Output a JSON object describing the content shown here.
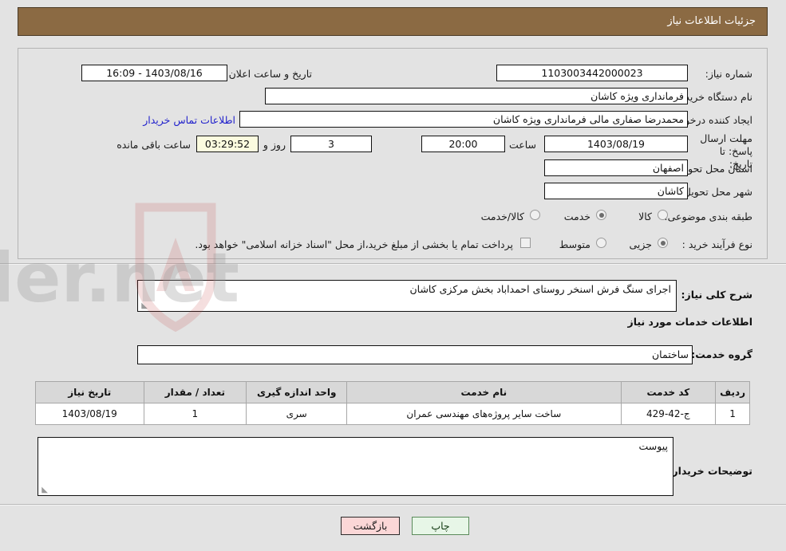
{
  "header": {
    "title": "جزئیات اطلاعات نیاز"
  },
  "form": {
    "need_number": {
      "label": "شماره نیاز:",
      "value": "1103003442000023"
    },
    "announce_datetime": {
      "label": "تاریخ و ساعت اعلان عمومی:",
      "value": "1403/08/16 - 16:09"
    },
    "buyer_org": {
      "label": "نام دستگاه خریدار:",
      "value": "فرمانداری ویژه کاشان"
    },
    "request_creator": {
      "label": "ایجاد کننده درخواست:",
      "value": "محمدرضا صفاری مالی فرمانداری ویژه کاشان"
    },
    "buyer_contact_link": "اطلاعات تماس خریدار",
    "deadline": {
      "label": "مهلت ارسال پاسخ: تا تاریخ:",
      "date": "1403/08/19",
      "hour_label": "ساعت",
      "hour": "20:00",
      "days": "3",
      "days_label": "روز و",
      "countdown": "03:29:52",
      "remaining_label": "ساعت باقی مانده"
    },
    "delivery_province": {
      "label": "استان محل تحویل:",
      "value": "اصفهان"
    },
    "delivery_city": {
      "label": "شهر محل تحویل:",
      "value": "کاشان"
    },
    "subject_category": {
      "label": "طبقه بندی موضوعی:",
      "options": [
        "کالا",
        "خدمت",
        "کالا/خدمت"
      ],
      "selected": "خدمت"
    },
    "purchase_type": {
      "label": "نوع فرآیند خرید :",
      "options": [
        "جزیی",
        "متوسط"
      ],
      "selected": "جزیی",
      "treasury_note": "پرداخت تمام یا بخشی از مبلغ خرید،از محل \"اسناد خزانه اسلامی\" خواهد بود."
    }
  },
  "description": {
    "label": "شرح کلی نیاز:",
    "value": "اجرای سنگ فرش اسنخر روستای احمداباد بخش مرکزی کاشان"
  },
  "services_section": {
    "title": "اطلاعات خدمات مورد نیاز",
    "group_label": "گروه خدمت:",
    "group_value": "ساختمان"
  },
  "table": {
    "columns": [
      "ردیف",
      "کد خدمت",
      "نام خدمت",
      "واحد اندازه گیری",
      "تعداد / مقدار",
      "تاریخ نیاز"
    ],
    "rows": [
      {
        "row": "1",
        "code": "ج-42-429",
        "name": "ساخت سایر پروژه‌های مهندسی عمران",
        "unit": "سری",
        "qty": "1",
        "date": "1403/08/19"
      }
    ]
  },
  "buyer_comments": {
    "label": "توضیحات خریدار:",
    "value": "پیوست"
  },
  "footer": {
    "print_label": "چاپ",
    "back_label": "بازگشت"
  },
  "watermark": {
    "text": "AriaTender.net"
  },
  "colors": {
    "header_bg": "#8b6a43",
    "page_bg": "#e3e3e3",
    "link": "#2222cc",
    "countdown_bg": "#fbfbdf",
    "print_btn_bg": "#e7f6e7",
    "back_btn_bg": "#fbd7d7"
  }
}
